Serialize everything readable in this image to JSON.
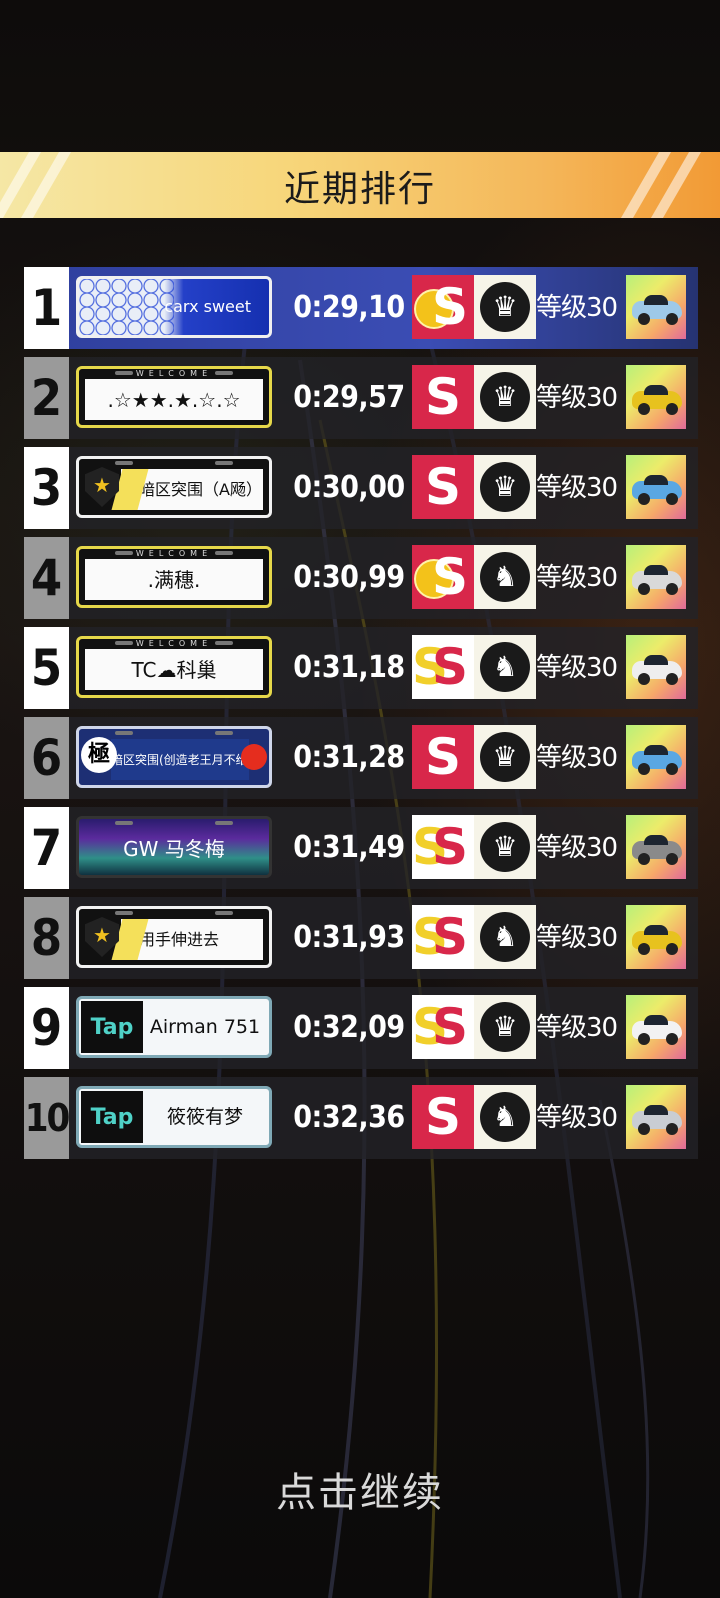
{
  "header": {
    "title": "近期排行"
  },
  "footer": {
    "continue_label": "点击继续"
  },
  "leaderboard": [
    {
      "rank": "1",
      "plate_style": "blue",
      "plate_text": "carx sweet",
      "time": "0:29,10",
      "s_badge": "double",
      "emblem": "crown",
      "level": "等级30",
      "car_color": "#9ec9e8"
    },
    {
      "rank": "2",
      "plate_style": "welcome",
      "plate_text": ".☆★★.★.☆.☆",
      "time": "0:29,57",
      "s_badge": "single",
      "emblem": "crown",
      "level": "等级30",
      "car_color": "#e7c21e"
    },
    {
      "rank": "3",
      "plate_style": "badge",
      "plate_text": "暗区突围（A飏）",
      "time": "0:30,00",
      "s_badge": "single",
      "emblem": "crown",
      "level": "等级30",
      "car_color": "#5aa7e2"
    },
    {
      "rank": "4",
      "plate_style": "welcome",
      "plate_text": ".满穗.",
      "time": "0:30,99",
      "s_badge": "double",
      "emblem": "horse",
      "level": "等级30",
      "car_color": "#d9d9d9"
    },
    {
      "rank": "5",
      "plate_style": "welcome",
      "plate_text": "TC☁科巢",
      "time": "0:31,18",
      "s_badge": "gold",
      "emblem": "horse",
      "level": "等级30",
      "car_color": "#eeeeee"
    },
    {
      "rank": "6",
      "plate_style": "navy",
      "plate_text": "暗区突围(创造老王月不给)",
      "plate_mark": "極",
      "time": "0:31,28",
      "s_badge": "single",
      "emblem": "crown",
      "level": "等级30",
      "car_color": "#5aa7e2"
    },
    {
      "rank": "7",
      "plate_style": "aurora",
      "plate_text": "GW 马冬梅",
      "time": "0:31,49",
      "s_badge": "gold",
      "emblem": "crown",
      "level": "等级30",
      "car_color": "#8a8a8a"
    },
    {
      "rank": "8",
      "plate_style": "badge",
      "plate_text": "用手伸进去",
      "time": "0:31,93",
      "s_badge": "gold",
      "emblem": "horse",
      "level": "等级30",
      "car_color": "#e7c21e"
    },
    {
      "rank": "9",
      "plate_style": "tap",
      "plate_logo": "Tap",
      "plate_text": "Airman 751",
      "time": "0:32,09",
      "s_badge": "gold",
      "emblem": "crown",
      "level": "等级30",
      "car_color": "#f2f2f2"
    },
    {
      "rank": "10",
      "plate_style": "tap",
      "plate_logo": "Tap",
      "plate_text": "筱筱有梦",
      "time": "0:32,36",
      "s_badge": "single",
      "emblem": "horse",
      "level": "等级30",
      "car_color": "#c9cdd3"
    }
  ],
  "colors": {
    "banner_start": "#f5e7a5",
    "banner_end": "#f29a35",
    "s_red": "#d8274a",
    "row_first": "#3b4db4"
  }
}
